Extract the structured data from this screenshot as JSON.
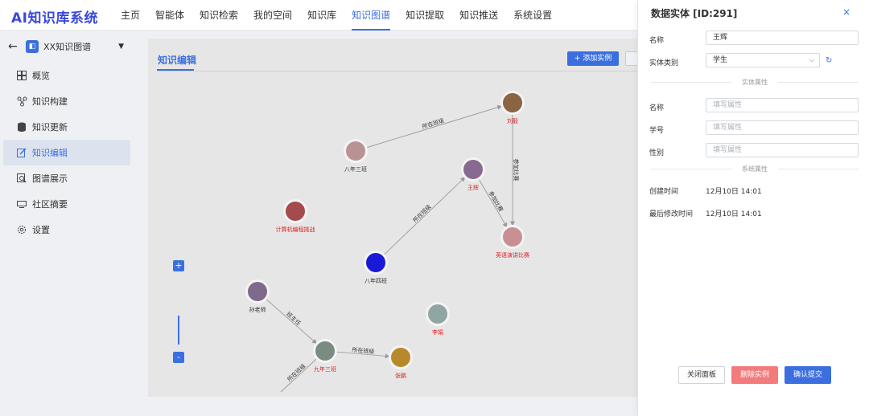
{
  "app": {
    "logo": "AI知识库系统"
  },
  "nav": [
    "主页",
    "智能体",
    "知识检索",
    "我的空间",
    "知识库",
    "知识图谱",
    "知识提取",
    "知识推送",
    "系统设置"
  ],
  "nav_active": 5,
  "sidebar": {
    "back_icon": "arrow-left-icon",
    "kb_name": "XX知识图谱",
    "items": [
      {
        "label": "概览",
        "icon": "grid-icon"
      },
      {
        "label": "知识构建",
        "icon": "graph-node-icon"
      },
      {
        "label": "知识更新",
        "icon": "database-icon"
      },
      {
        "label": "知识编辑",
        "icon": "edit-icon"
      },
      {
        "label": "图谱展示",
        "icon": "magnifier-icon"
      },
      {
        "label": "社区摘要",
        "icon": "monitor-icon"
      },
      {
        "label": "设置",
        "icon": "gear-icon"
      }
    ],
    "active_index": 3
  },
  "main": {
    "tab": "知识编辑",
    "add_button": "+ 添加实例",
    "zoom_in": "+",
    "zoom_out": "-"
  },
  "graph": {
    "nodes": [
      {
        "id": "n1",
        "label": "刘毅",
        "color": "#8a6443",
        "label_color": "#e02020"
      },
      {
        "id": "n2",
        "label": "八年三班",
        "color": "#b99294",
        "label_color": "#333333"
      },
      {
        "id": "n3",
        "label": "王辉",
        "color": "#876a8f",
        "label_color": "#e02020"
      },
      {
        "id": "n4",
        "label": "英语演讲比赛",
        "color": "#c99093",
        "label_color": "#e02020"
      },
      {
        "id": "n5",
        "label": "计算机编程挑战",
        "color": "#a64b4d",
        "label_color": "#e02020"
      },
      {
        "id": "n6",
        "label": "八年四班",
        "color": "#1a1ad6",
        "label_color": "#333333"
      },
      {
        "id": "n7",
        "label": "孙老师",
        "color": "#806a8c",
        "label_color": "#333333"
      },
      {
        "id": "n8",
        "label": "李娟",
        "color": "#8fa6a3",
        "label_color": "#e02020"
      },
      {
        "id": "n9",
        "label": "九年三班",
        "color": "#7a8c82",
        "label_color": "#e02020"
      },
      {
        "id": "n10",
        "label": "张鹏",
        "color": "#b8892b",
        "label_color": "#e02020"
      }
    ],
    "edges": [
      {
        "from": "n2",
        "to": "n1",
        "label": "所在班级"
      },
      {
        "from": "n1",
        "to": "n4",
        "label": "参加比赛"
      },
      {
        "from": "n3",
        "to": "n4",
        "label": "参加比赛"
      },
      {
        "from": "n6",
        "to": "n3",
        "label": "所在班级"
      },
      {
        "from": "n7",
        "to": "n9",
        "label": "班主任"
      },
      {
        "from": "n9",
        "to": "n10",
        "label": "所在班级"
      },
      {
        "from": "n9",
        "to": "nx",
        "label": "所在班级"
      }
    ]
  },
  "panel": {
    "title": "数据实体 [ID:291]",
    "close": "×",
    "name_label": "名称",
    "name_value": "王辉",
    "type_label": "实体类别",
    "type_value": "学生",
    "section_entity": "实体属性",
    "attrs": [
      {
        "label": "名称",
        "placeholder": "填写属性"
      },
      {
        "label": "学号",
        "placeholder": "填写属性"
      },
      {
        "label": "性别",
        "placeholder": "填写属性"
      }
    ],
    "section_system": "系统属性",
    "created_label": "创建时间",
    "created_value": "12月10日 14:01",
    "modified_label": "最后修改时间",
    "modified_value": "12月10日 14:01",
    "btn_close": "关闭面板",
    "btn_delete": "删除实例",
    "btn_submit": "确认提交"
  },
  "colors": {
    "accent": "#3b6fe0",
    "danger": "#f37b7b",
    "node_label_red": "#e02020"
  }
}
